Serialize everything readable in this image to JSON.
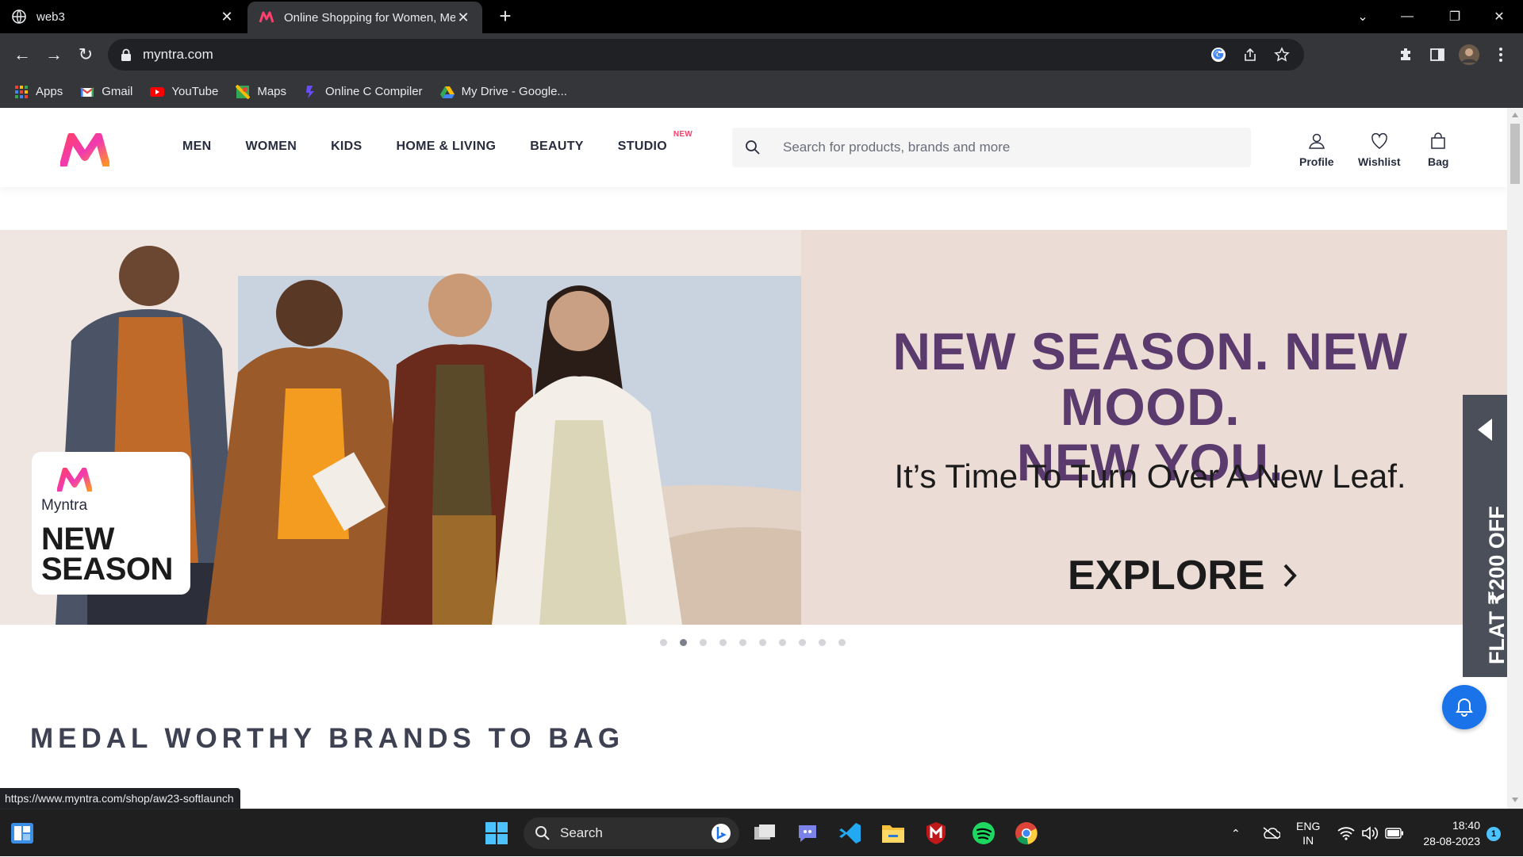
{
  "browser": {
    "tabs": [
      {
        "title": "web3",
        "active": false
      },
      {
        "title": "Online Shopping for Women, Me",
        "active": true
      }
    ],
    "new_tab": "+",
    "url": "myntra.com",
    "bookmarks": [
      "Apps",
      "Gmail",
      "YouTube",
      "Maps",
      "Online C Compiler",
      "My Drive - Google..."
    ],
    "status_url": "https://www.myntra.com/shop/aw23-softlaunch"
  },
  "site": {
    "nav": [
      "MEN",
      "WOMEN",
      "KIDS",
      "HOME & LIVING",
      "BEAUTY",
      "STUDIO"
    ],
    "nav_badge": "NEW",
    "search_placeholder": "Search for products, brands and more",
    "actions": {
      "profile": "Profile",
      "wishlist": "Wishlist",
      "bag": "Bag"
    },
    "banner": {
      "brand": "Myntra",
      "tag_line1": "NEW",
      "tag_line2": "SEASON",
      "headline1": "NEW SEASON. NEW MOOD.",
      "headline2": "NEW YOU.",
      "subline": "It’s Time To Turn Over A New Leaf.",
      "cta": "EXPLORE",
      "headline_color": "#5b3a6e"
    },
    "carousel": {
      "count": 10,
      "active_index": 1
    },
    "section_title": "MEDAL WORTHY BRANDS TO BAG",
    "side_offer": "FLAT ₹200 OFF",
    "brand_color": "#ff3f6c"
  },
  "taskbar": {
    "search": "Search",
    "lang1": "ENG",
    "lang2": "IN",
    "time": "18:40",
    "date": "28-08-2023",
    "notifications": "1"
  }
}
